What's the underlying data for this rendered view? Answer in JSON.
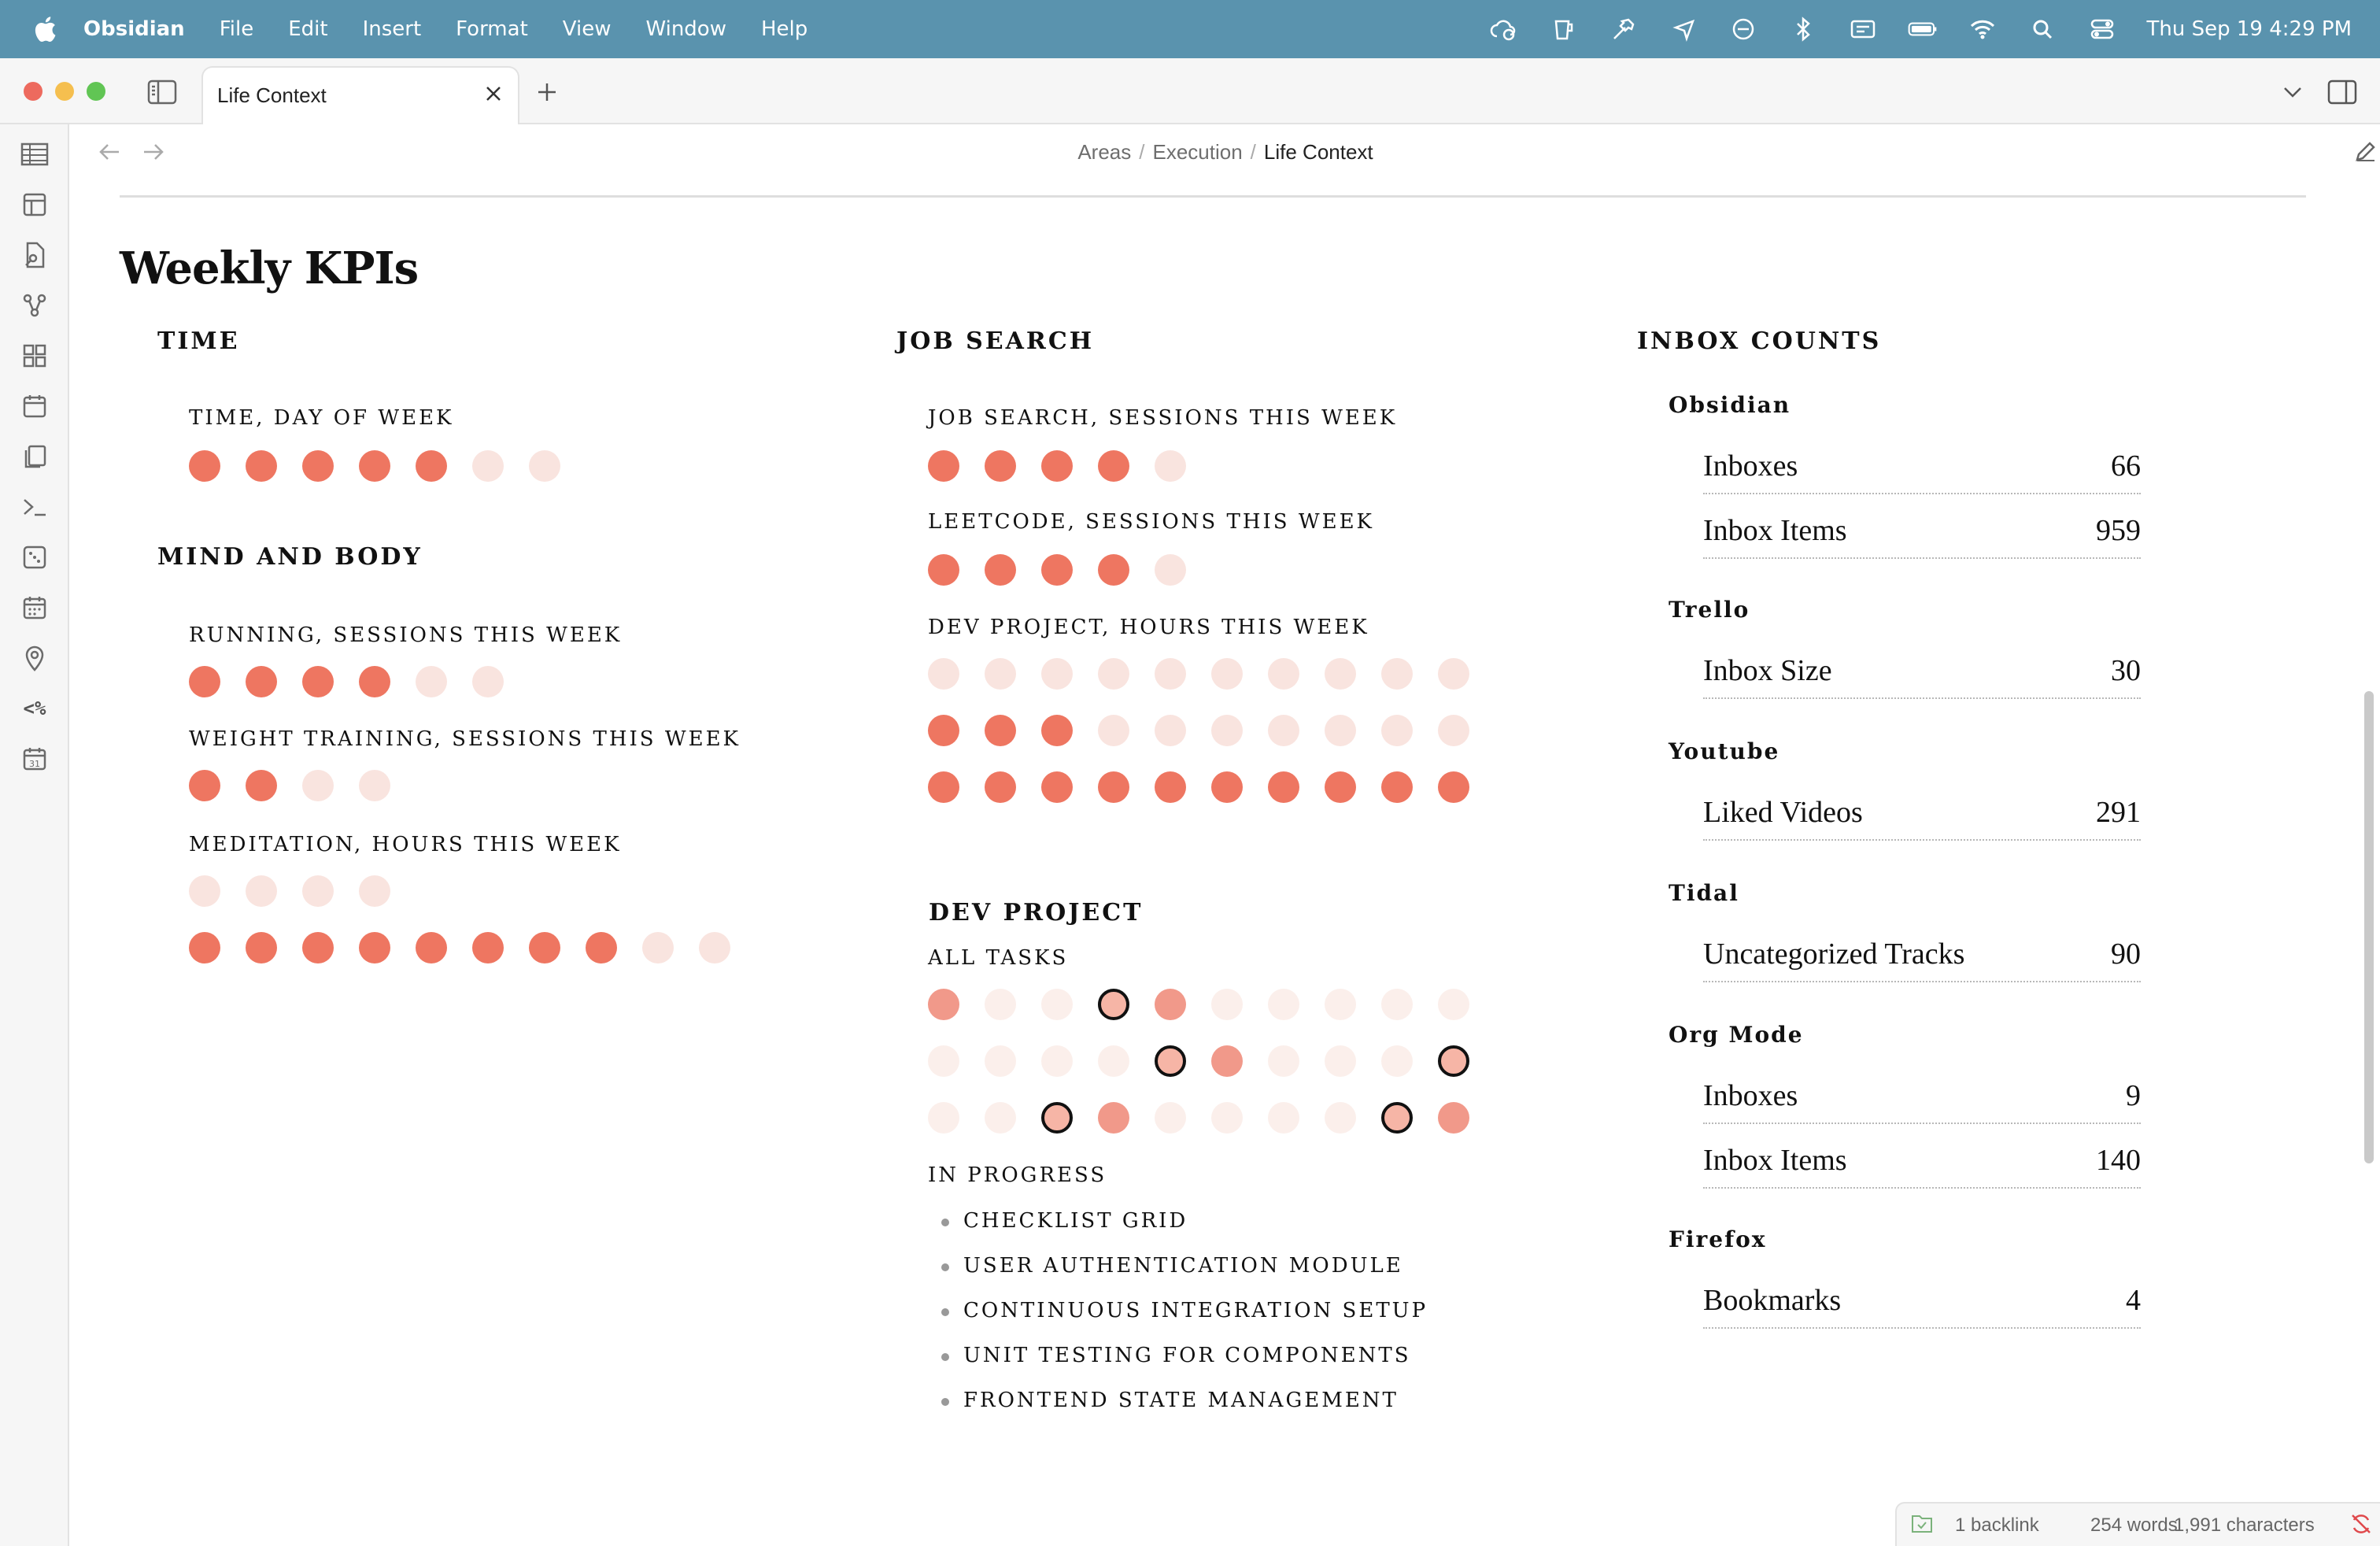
{
  "menubar": {
    "app_name": "Obsidian",
    "menus": [
      "File",
      "Edit",
      "Insert",
      "Format",
      "View",
      "Window",
      "Help"
    ],
    "clock": "Thu Sep 19  4:29 PM"
  },
  "tab": {
    "title": "Life Context"
  },
  "breadcrumb": {
    "part1": "Areas",
    "part2": "Execution",
    "current": "Life Context",
    "sep": "/"
  },
  "page": {
    "title": "Weekly KPIs"
  },
  "sections": {
    "time": {
      "heading": "TIME",
      "kpis": [
        {
          "label": "TIME, DAY OF WEEK",
          "filled": 5,
          "total": 7
        }
      ]
    },
    "mind_body": {
      "heading": "MIND AND BODY",
      "kpis": [
        {
          "label": "RUNNING, SESSIONS THIS WEEK",
          "filled": 4,
          "total": 6
        },
        {
          "label": "WEIGHT TRAINING, SESSIONS THIS WEEK",
          "filled": 2,
          "total": 4
        },
        {
          "label": "MEDITATION, HOURS THIS WEEK",
          "rows": [
            {
              "filled": 0,
              "total": 4
            },
            {
              "filled": 8,
              "total": 10
            }
          ]
        }
      ]
    },
    "job_search": {
      "heading": "JOB SEARCH",
      "kpis": [
        {
          "label": "JOB SEARCH, SESSIONS THIS WEEK",
          "filled": 4,
          "total": 5
        },
        {
          "label": "LEETCODE, SESSIONS THIS WEEK",
          "filled": 4,
          "total": 5
        },
        {
          "label": "DEV PROJECT, HOURS THIS WEEK",
          "rows": [
            {
              "filled": 0,
              "total": 10
            },
            {
              "filled": 3,
              "total": 10
            },
            {
              "filled": 10,
              "total": 10
            }
          ]
        }
      ]
    },
    "dev_project": {
      "heading": "DEV PROJECT",
      "all_tasks_label": "ALL TASKS",
      "task_rows": [
        [
          "mid",
          "faint",
          "faint",
          "ring",
          "mid",
          "faint",
          "faint",
          "faint",
          "faint",
          "faint"
        ],
        [
          "faint",
          "faint",
          "faint",
          "faint",
          "ring",
          "mid",
          "faint",
          "faint",
          "faint",
          "ring"
        ],
        [
          "faint",
          "faint",
          "ring",
          "mid",
          "faint",
          "faint",
          "faint",
          "faint",
          "ring",
          "mid"
        ]
      ],
      "in_progress_label": "IN PROGRESS",
      "in_progress": [
        "CHECKLIST GRID",
        "USER AUTHENTICATION MODULE",
        "CONTINUOUS INTEGRATION SETUP",
        "UNIT TESTING FOR COMPONENTS",
        "FRONTEND STATE MANAGEMENT"
      ]
    },
    "inbox_counts": {
      "heading": "INBOX COUNTS",
      "groups": [
        {
          "name": "Obsidian",
          "rows": [
            {
              "label": "Inboxes",
              "value": "66"
            },
            {
              "label": "Inbox Items",
              "value": "959"
            }
          ]
        },
        {
          "name": "Trello",
          "rows": [
            {
              "label": "Inbox Size",
              "value": "30"
            }
          ]
        },
        {
          "name": "Youtube",
          "rows": [
            {
              "label": "Liked Videos",
              "value": "291"
            }
          ]
        },
        {
          "name": "Tidal",
          "rows": [
            {
              "label": "Uncategorized Tracks",
              "value": "90"
            }
          ]
        },
        {
          "name": "Org Mode",
          "rows": [
            {
              "label": "Inboxes",
              "value": "9"
            },
            {
              "label": "Inbox Items",
              "value": "140"
            }
          ]
        },
        {
          "name": "Firefox",
          "rows": [
            {
              "label": "Bookmarks",
              "value": "4"
            }
          ]
        }
      ]
    }
  },
  "statusbar": {
    "backlinks": "1 backlink",
    "words": "254 words",
    "characters": "1,991 characters"
  },
  "colors": {
    "dot_on": "#ee7661",
    "dot_off": "#f9e4df",
    "menubar": "#5a93ae"
  },
  "icons": {
    "ribbon": [
      "table-icon",
      "layout-icon",
      "search-file-icon",
      "graph-icon",
      "blocks-icon",
      "calendar-icon",
      "copy-icon",
      "terminal-icon",
      "dice-icon",
      "calendar-grid-icon",
      "map-pin-icon",
      "templater-icon",
      "calendar-31-icon"
    ]
  }
}
